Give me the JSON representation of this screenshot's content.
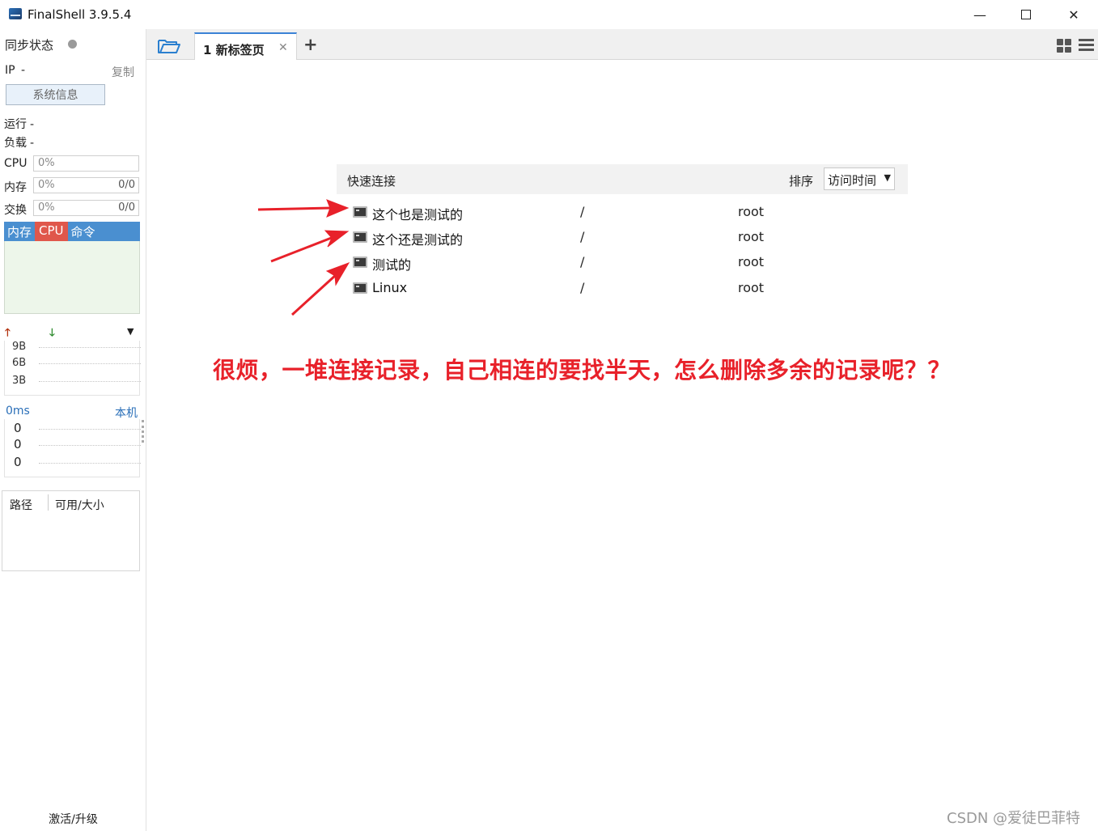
{
  "window": {
    "title": "FinalShell 3.9.5.4"
  },
  "sidebar": {
    "sync_status": "同步状态",
    "ip_label": "IP",
    "ip_value": "-",
    "copy_label": "复制",
    "sysinfo_button": "系统信息",
    "running_label": "运行",
    "running_value": "-",
    "load_label": "负载",
    "load_value": "-",
    "cpu_label": "CPU",
    "cpu_value": "0%",
    "mem_label": "内存",
    "mem_value": "0%",
    "mem_ratio": "0/0",
    "swap_label": "交换",
    "swap_value": "0%",
    "swap_ratio": "0/0",
    "proc_tabs": [
      "内存",
      "CPU",
      "命令"
    ],
    "net_labels": [
      "9B",
      "6B",
      "3B"
    ],
    "ping_value": "0ms",
    "host_label": "本机",
    "ping_rows": [
      "0",
      "0",
      "0"
    ],
    "disk_path_header": "路径",
    "disk_size_header": "可用/大小",
    "activate": "激活/升级"
  },
  "tabs": {
    "active_tab": "1 新标签页"
  },
  "quick_connect": {
    "title": "快速连接",
    "sort_label": "排序",
    "sort_value": "访问时间",
    "connections": [
      {
        "name": "这个也是测试的",
        "path": "/",
        "user": "root"
      },
      {
        "name": "这个还是测试的",
        "path": "/",
        "user": "root"
      },
      {
        "name": "测试的",
        "path": "/",
        "user": "root"
      },
      {
        "name": "Linux",
        "path": "/",
        "user": "root"
      }
    ]
  },
  "annotation": "很烦，一堆连接记录，自己相连的要找半天，怎么删除多余的记录呢？？",
  "watermark": "CSDN @爱徒巴菲特",
  "colors": {
    "accent": "#3b82d6",
    "annotation": "#e8212a",
    "cpu_tab": "#e0574b",
    "proc_tabs": "#4a8fd0"
  }
}
